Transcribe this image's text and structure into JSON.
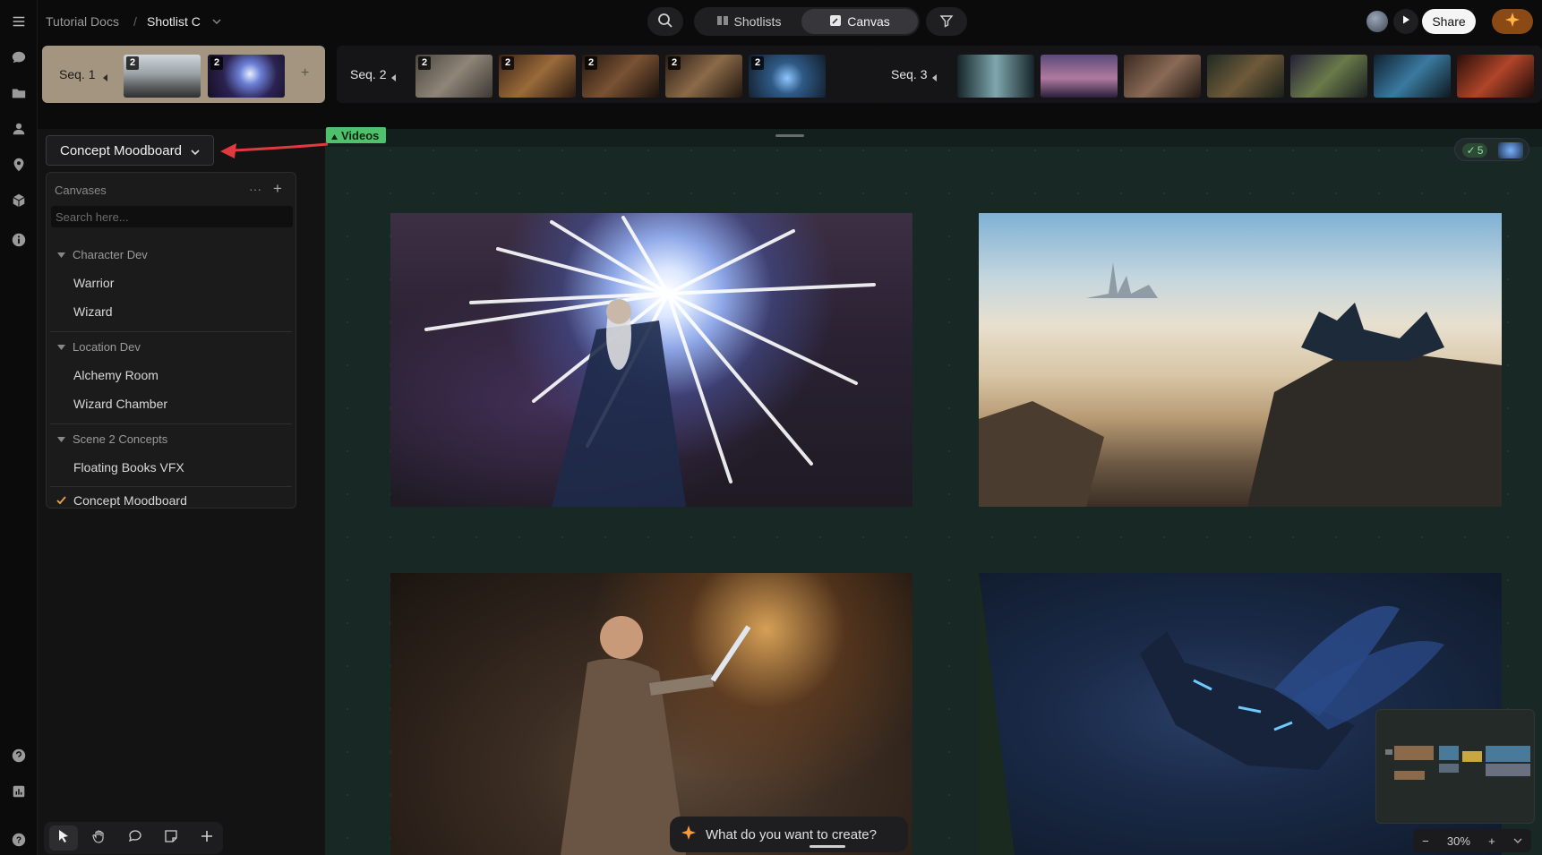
{
  "breadcrumb": {
    "project": "Tutorial Docs",
    "separator": "/",
    "shotlist": "Shotlist C"
  },
  "header": {
    "tabs": [
      {
        "label": "Shotlists"
      },
      {
        "label": "Canvas"
      }
    ],
    "share_label": "Share"
  },
  "sequences": [
    {
      "label": "Seq. 1",
      "active": true,
      "thumbs": [
        {
          "count": "2"
        },
        {
          "count": "2"
        }
      ]
    },
    {
      "label": "Seq. 2",
      "active": false,
      "thumbs": [
        {
          "count": "2"
        },
        {
          "count": "2"
        },
        {
          "count": "2"
        },
        {
          "count": "2"
        },
        {
          "count": "2"
        }
      ]
    },
    {
      "label": "Seq. 3",
      "active": false,
      "thumbs": [
        {},
        {},
        {},
        {},
        {},
        {},
        {}
      ]
    }
  ],
  "sidebar": {
    "selected_canvas": "Concept Moodboard",
    "panel_title": "Canvases",
    "search_placeholder": "Search here...",
    "groups": [
      {
        "name": "Character Dev",
        "items": [
          "Warrior",
          "Wizard"
        ]
      },
      {
        "name": "Location Dev",
        "items": [
          "Alchemy Room",
          "Wizard Chamber"
        ]
      },
      {
        "name": "Scene 2 Concepts",
        "items": [
          "Floating Books VFX"
        ]
      }
    ],
    "current_item": "Concept Moodboard"
  },
  "canvas": {
    "videos_label": "Videos",
    "selection_count": "5",
    "images": [
      {
        "name": "wizard-spell-image"
      },
      {
        "name": "fox-cliff-image"
      },
      {
        "name": "warrior-sword-image"
      },
      {
        "name": "spirit-fox-forest-image"
      }
    ]
  },
  "prompt_bar": {
    "placeholder": "What do you want to create?"
  },
  "zoom": {
    "level": "30%",
    "minus": "−",
    "plus": "+"
  },
  "colors": {
    "accent": "#4fc06b",
    "active_sequence": "#a39580",
    "canvas_bg": "#182925",
    "annotation_arrow": "#e0393e"
  }
}
